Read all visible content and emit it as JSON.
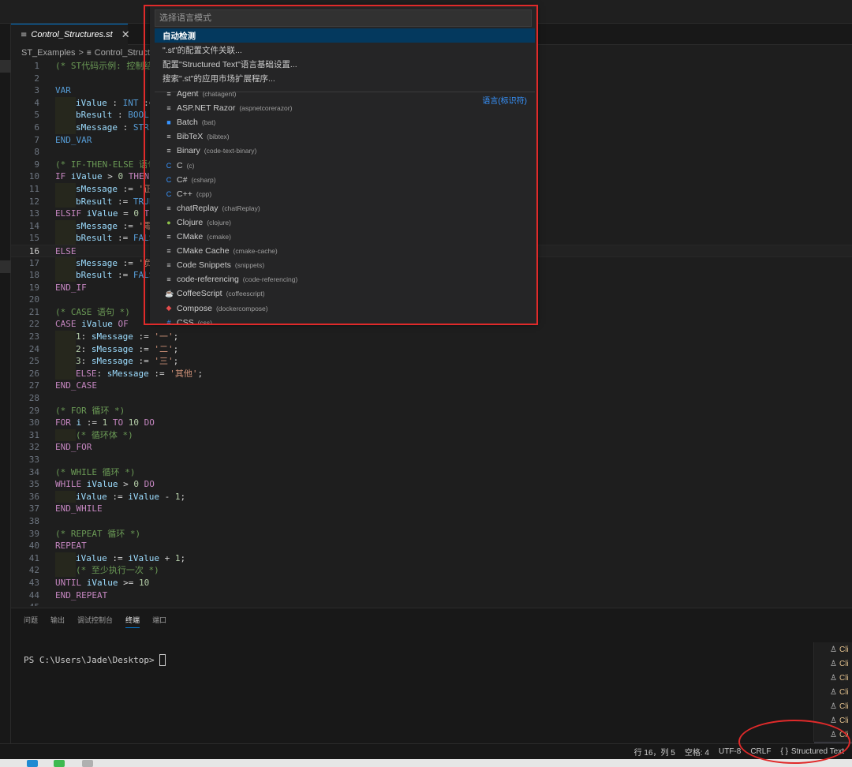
{
  "tab": {
    "name": "Control_Structures.st",
    "close": "✕"
  },
  "breadcrumb": {
    "folder": "ST_Examples",
    "separator": ">",
    "file": "Control_Structu"
  },
  "editor": {
    "current_line": 16,
    "lines": [
      {
        "n": 1,
        "indent": 0,
        "tokens": [
          {
            "t": "(* ST代码示例: 控制结",
            "c": "cm"
          }
        ]
      },
      {
        "n": 2,
        "indent": 0,
        "tokens": []
      },
      {
        "n": 3,
        "indent": 0,
        "tokens": [
          {
            "t": "VAR",
            "c": "ty"
          }
        ]
      },
      {
        "n": 4,
        "indent": 1,
        "tokens": [
          {
            "t": "iValue",
            "c": "var"
          },
          {
            "t": " : ",
            "c": ""
          },
          {
            "t": "INT",
            "c": "ty"
          },
          {
            "t": " :=",
            "c": ""
          }
        ]
      },
      {
        "n": 5,
        "indent": 1,
        "tokens": [
          {
            "t": "bResult",
            "c": "var"
          },
          {
            "t": " : ",
            "c": ""
          },
          {
            "t": "BOOL",
            "c": "ty"
          },
          {
            "t": ";",
            "c": ""
          }
        ]
      },
      {
        "n": 6,
        "indent": 1,
        "tokens": [
          {
            "t": "sMessage",
            "c": "var"
          },
          {
            "t": " : ",
            "c": ""
          },
          {
            "t": "STRI",
            "c": "ty"
          }
        ]
      },
      {
        "n": 7,
        "indent": 0,
        "tokens": [
          {
            "t": "END_VAR",
            "c": "ty"
          }
        ]
      },
      {
        "n": 8,
        "indent": 0,
        "tokens": []
      },
      {
        "n": 9,
        "indent": 0,
        "tokens": [
          {
            "t": "(* IF-THEN-ELSE 语句",
            "c": "cm"
          }
        ]
      },
      {
        "n": 10,
        "indent": 0,
        "tokens": [
          {
            "t": "IF",
            "c": "kw"
          },
          {
            "t": " ",
            "c": ""
          },
          {
            "t": "iValue",
            "c": "var"
          },
          {
            "t": " > ",
            "c": ""
          },
          {
            "t": "0",
            "c": "num"
          },
          {
            "t": " ",
            "c": ""
          },
          {
            "t": "THEN",
            "c": "kw"
          }
        ]
      },
      {
        "n": 11,
        "indent": 1,
        "tokens": [
          {
            "t": "sMessage",
            "c": "var"
          },
          {
            "t": " := ",
            "c": ""
          },
          {
            "t": "'正",
            "c": "str"
          }
        ]
      },
      {
        "n": 12,
        "indent": 1,
        "tokens": [
          {
            "t": "bResult",
            "c": "var"
          },
          {
            "t": " := ",
            "c": ""
          },
          {
            "t": "TRUE",
            "c": "ty"
          }
        ]
      },
      {
        "n": 13,
        "indent": 0,
        "tokens": [
          {
            "t": "ELSIF",
            "c": "kw"
          },
          {
            "t": " ",
            "c": ""
          },
          {
            "t": "iValue",
            "c": "var"
          },
          {
            "t": " = ",
            "c": ""
          },
          {
            "t": "0",
            "c": "num"
          },
          {
            "t": " ",
            "c": ""
          },
          {
            "t": "TH",
            "c": "kw"
          }
        ]
      },
      {
        "n": 14,
        "indent": 1,
        "tokens": [
          {
            "t": "sMessage",
            "c": "var"
          },
          {
            "t": " := ",
            "c": ""
          },
          {
            "t": "'零",
            "c": "str"
          }
        ]
      },
      {
        "n": 15,
        "indent": 1,
        "tokens": [
          {
            "t": "bResult",
            "c": "var"
          },
          {
            "t": " := ",
            "c": ""
          },
          {
            "t": "FALS",
            "c": "ty"
          }
        ]
      },
      {
        "n": 16,
        "indent": 0,
        "tokens": [
          {
            "t": "ELSE",
            "c": "kw"
          }
        ]
      },
      {
        "n": 17,
        "indent": 1,
        "tokens": [
          {
            "t": "sMessage",
            "c": "var"
          },
          {
            "t": " := ",
            "c": ""
          },
          {
            "t": "'负",
            "c": "str"
          }
        ]
      },
      {
        "n": 18,
        "indent": 1,
        "tokens": [
          {
            "t": "bResult",
            "c": "var"
          },
          {
            "t": " := ",
            "c": ""
          },
          {
            "t": "FALS",
            "c": "ty"
          }
        ]
      },
      {
        "n": 19,
        "indent": 0,
        "tokens": [
          {
            "t": "END_IF",
            "c": "kw"
          }
        ]
      },
      {
        "n": 20,
        "indent": 0,
        "tokens": []
      },
      {
        "n": 21,
        "indent": 0,
        "tokens": [
          {
            "t": "(* CASE 语句 *)",
            "c": "cm"
          }
        ]
      },
      {
        "n": 22,
        "indent": 0,
        "tokens": [
          {
            "t": "CASE",
            "c": "kw"
          },
          {
            "t": " ",
            "c": ""
          },
          {
            "t": "iValue",
            "c": "var"
          },
          {
            "t": " ",
            "c": ""
          },
          {
            "t": "OF",
            "c": "kw"
          }
        ]
      },
      {
        "n": 23,
        "indent": 1,
        "tokens": [
          {
            "t": "1",
            "c": "num"
          },
          {
            "t": ": ",
            "c": ""
          },
          {
            "t": "sMessage",
            "c": "var"
          },
          {
            "t": " := ",
            "c": ""
          },
          {
            "t": "'一'",
            "c": "str"
          },
          {
            "t": ";",
            "c": ""
          }
        ]
      },
      {
        "n": 24,
        "indent": 1,
        "tokens": [
          {
            "t": "2",
            "c": "num"
          },
          {
            "t": ": ",
            "c": ""
          },
          {
            "t": "sMessage",
            "c": "var"
          },
          {
            "t": " := ",
            "c": ""
          },
          {
            "t": "'二'",
            "c": "str"
          },
          {
            "t": ";",
            "c": ""
          }
        ]
      },
      {
        "n": 25,
        "indent": 1,
        "tokens": [
          {
            "t": "3",
            "c": "num"
          },
          {
            "t": ": ",
            "c": ""
          },
          {
            "t": "sMessage",
            "c": "var"
          },
          {
            "t": " := ",
            "c": ""
          },
          {
            "t": "'三'",
            "c": "str"
          },
          {
            "t": ";",
            "c": ""
          }
        ]
      },
      {
        "n": 26,
        "indent": 1,
        "tokens": [
          {
            "t": "ELSE",
            "c": "kw"
          },
          {
            "t": ": ",
            "c": ""
          },
          {
            "t": "sMessage",
            "c": "var"
          },
          {
            "t": " := ",
            "c": ""
          },
          {
            "t": "'其他'",
            "c": "str"
          },
          {
            "t": ";",
            "c": ""
          }
        ]
      },
      {
        "n": 27,
        "indent": 0,
        "tokens": [
          {
            "t": "END_CASE",
            "c": "kw"
          }
        ]
      },
      {
        "n": 28,
        "indent": 0,
        "tokens": []
      },
      {
        "n": 29,
        "indent": 0,
        "tokens": [
          {
            "t": "(* FOR 循环 *)",
            "c": "cm"
          }
        ]
      },
      {
        "n": 30,
        "indent": 0,
        "tokens": [
          {
            "t": "FOR",
            "c": "kw"
          },
          {
            "t": " ",
            "c": ""
          },
          {
            "t": "i",
            "c": "var"
          },
          {
            "t": " := ",
            "c": ""
          },
          {
            "t": "1",
            "c": "num"
          },
          {
            "t": " ",
            "c": ""
          },
          {
            "t": "TO",
            "c": "kw"
          },
          {
            "t": " ",
            "c": ""
          },
          {
            "t": "10",
            "c": "num"
          },
          {
            "t": " ",
            "c": ""
          },
          {
            "t": "DO",
            "c": "kw"
          }
        ]
      },
      {
        "n": 31,
        "indent": 1,
        "tokens": [
          {
            "t": "(* 循环体 *)",
            "c": "cm"
          }
        ]
      },
      {
        "n": 32,
        "indent": 0,
        "tokens": [
          {
            "t": "END_FOR",
            "c": "kw"
          }
        ]
      },
      {
        "n": 33,
        "indent": 0,
        "tokens": []
      },
      {
        "n": 34,
        "indent": 0,
        "tokens": [
          {
            "t": "(* WHILE 循环 *)",
            "c": "cm"
          }
        ]
      },
      {
        "n": 35,
        "indent": 0,
        "tokens": [
          {
            "t": "WHILE",
            "c": "kw"
          },
          {
            "t": " ",
            "c": ""
          },
          {
            "t": "iValue",
            "c": "var"
          },
          {
            "t": " > ",
            "c": ""
          },
          {
            "t": "0",
            "c": "num"
          },
          {
            "t": " ",
            "c": ""
          },
          {
            "t": "DO",
            "c": "kw"
          }
        ]
      },
      {
        "n": 36,
        "indent": 1,
        "tokens": [
          {
            "t": "iValue",
            "c": "var"
          },
          {
            "t": " := ",
            "c": ""
          },
          {
            "t": "iValue",
            "c": "var"
          },
          {
            "t": " - ",
            "c": ""
          },
          {
            "t": "1",
            "c": "num"
          },
          {
            "t": ";",
            "c": ""
          }
        ]
      },
      {
        "n": 37,
        "indent": 0,
        "tokens": [
          {
            "t": "END_WHILE",
            "c": "kw"
          }
        ]
      },
      {
        "n": 38,
        "indent": 0,
        "tokens": []
      },
      {
        "n": 39,
        "indent": 0,
        "tokens": [
          {
            "t": "(* REPEAT 循环 *)",
            "c": "cm"
          }
        ]
      },
      {
        "n": 40,
        "indent": 0,
        "tokens": [
          {
            "t": "REPEAT",
            "c": "kw"
          }
        ]
      },
      {
        "n": 41,
        "indent": 1,
        "tokens": [
          {
            "t": "iValue",
            "c": "var"
          },
          {
            "t": " := ",
            "c": ""
          },
          {
            "t": "iValue",
            "c": "var"
          },
          {
            "t": " + ",
            "c": ""
          },
          {
            "t": "1",
            "c": "num"
          },
          {
            "t": ";",
            "c": ""
          }
        ]
      },
      {
        "n": 42,
        "indent": 1,
        "tokens": [
          {
            "t": "(* 至少执行一次 *)",
            "c": "cm"
          }
        ]
      },
      {
        "n": 43,
        "indent": 0,
        "tokens": [
          {
            "t": "UNTIL",
            "c": "kw"
          },
          {
            "t": " ",
            "c": ""
          },
          {
            "t": "iValue",
            "c": "var"
          },
          {
            "t": " >= ",
            "c": ""
          },
          {
            "t": "10",
            "c": "num"
          }
        ]
      },
      {
        "n": 44,
        "indent": 0,
        "tokens": [
          {
            "t": "END_REPEAT",
            "c": "kw"
          }
        ]
      },
      {
        "n": 45,
        "indent": 0,
        "tokens": []
      }
    ]
  },
  "panel": {
    "tabs": [
      "问题",
      "输出",
      "调试控制台",
      "终端",
      "端口"
    ],
    "active_tab": "终端",
    "terminal_prompt": "PS C:\\Users\\Jade\\Desktop>"
  },
  "terminal_list": {
    "items": [
      "Cli",
      "Cli",
      "Cli",
      "Cli",
      "Cli",
      "Cli",
      "Cli",
      "Po"
    ]
  },
  "statusbar": {
    "position": "行 16，列 5",
    "spaces": "空格: 4",
    "encoding": "UTF-8",
    "eol": "CRLF",
    "language_icon": "{ }",
    "language": "Structured Text"
  },
  "picker": {
    "placeholder": "选择语言模式",
    "options": [
      "自动检测",
      "\".st\"的配置文件关联...",
      "配置\"Structured Text\"语言基础设置...",
      "搜索\".st\"的应用市场扩展程序..."
    ],
    "section_label": "语言(标识符)",
    "languages": [
      {
        "name": "Agent",
        "id": "(chatagent)",
        "icon": "file-lines-icon",
        "glyph": "≡",
        "color": "#cccccc"
      },
      {
        "name": "ASP.NET Razor",
        "id": "(aspnetcorerazor)",
        "icon": "file-lines-icon",
        "glyph": "≡",
        "color": "#cccccc"
      },
      {
        "name": "Batch",
        "id": "(bat)",
        "icon": "windows-icon",
        "glyph": "■",
        "color": "#3794ff"
      },
      {
        "name": "BibTeX",
        "id": "(bibtex)",
        "icon": "file-lines-icon",
        "glyph": "≡",
        "color": "#cccccc"
      },
      {
        "name": "Binary",
        "id": "(code-text-binary)",
        "icon": "file-lines-icon",
        "glyph": "≡",
        "color": "#cccccc"
      },
      {
        "name": "C",
        "id": "(c)",
        "icon": "c-language-icon",
        "glyph": "C",
        "color": "#3794ff"
      },
      {
        "name": "C#",
        "id": "(csharp)",
        "icon": "csharp-icon",
        "glyph": "C",
        "color": "#3794ff"
      },
      {
        "name": "C++",
        "id": "(cpp)",
        "icon": "cpp-icon",
        "glyph": "C",
        "color": "#3794ff"
      },
      {
        "name": "chatReplay",
        "id": "(chatReplay)",
        "icon": "file-lines-icon",
        "glyph": "≡",
        "color": "#cccccc"
      },
      {
        "name": "Clojure",
        "id": "(clojure)",
        "icon": "clojure-icon",
        "glyph": "●",
        "color": "#8dc149"
      },
      {
        "name": "CMake",
        "id": "(cmake)",
        "icon": "file-lines-icon",
        "glyph": "≡",
        "color": "#cccccc"
      },
      {
        "name": "CMake Cache",
        "id": "(cmake-cache)",
        "icon": "file-lines-icon",
        "glyph": "≡",
        "color": "#cccccc"
      },
      {
        "name": "Code Snippets",
        "id": "(snippets)",
        "icon": "file-lines-icon",
        "glyph": "≡",
        "color": "#cccccc"
      },
      {
        "name": "code-referencing",
        "id": "(code-referencing)",
        "icon": "file-lines-icon",
        "glyph": "≡",
        "color": "#cccccc"
      },
      {
        "name": "CoffeeScript",
        "id": "(coffeescript)",
        "icon": "coffee-icon",
        "glyph": "☕",
        "color": "#cbcb41"
      },
      {
        "name": "Compose",
        "id": "(dockercompose)",
        "icon": "docker-icon",
        "glyph": "◆",
        "color": "#e44c4c"
      },
      {
        "name": "CSS",
        "id": "(css)",
        "icon": "css-hash-icon",
        "glyph": "#",
        "color": "#3794ff"
      }
    ]
  }
}
